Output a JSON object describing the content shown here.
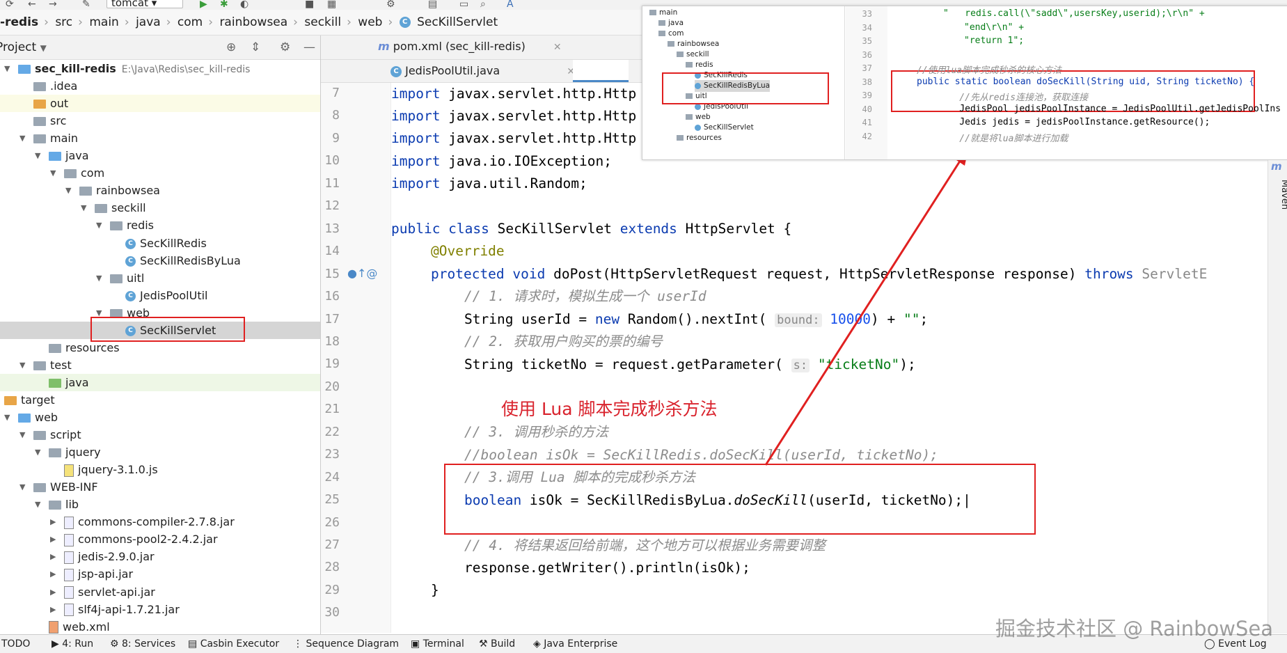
{
  "toolbar": {
    "run_config": "tomcat"
  },
  "breadcrumb": [
    "-redis",
    "src",
    "main",
    "java",
    "com",
    "rainbowsea",
    "seckill",
    "web",
    "SecKillServlet"
  ],
  "project_panel": {
    "title": "Project"
  },
  "tree": [
    {
      "label": "sec_kill-redis",
      "extra": "E:\\Java\\Redis\\sec_kill-redis",
      "indent": 0,
      "arrow": "▼",
      "icon": "module"
    },
    {
      "label": ".idea",
      "indent": 1,
      "icon": "folder"
    },
    {
      "label": "out",
      "indent": 1,
      "icon": "folder-orange"
    },
    {
      "label": "src",
      "indent": 1,
      "icon": "folder"
    },
    {
      "label": "main",
      "indent": 1,
      "arrow": "▼",
      "icon": "folder"
    },
    {
      "label": "java",
      "indent": 2,
      "arrow": "▼",
      "icon": "folder-blue"
    },
    {
      "label": "com",
      "indent": 3,
      "arrow": "▼",
      "icon": "folder"
    },
    {
      "label": "rainbowsea",
      "indent": 4,
      "arrow": "▼",
      "icon": "folder"
    },
    {
      "label": "seckill",
      "indent": 5,
      "arrow": "▼",
      "icon": "folder"
    },
    {
      "label": "redis",
      "indent": 6,
      "arrow": "▼",
      "icon": "folder"
    },
    {
      "label": "SecKillRedis",
      "indent": 7,
      "icon": "class"
    },
    {
      "label": "SecKillRedisByLua",
      "indent": 7,
      "icon": "class"
    },
    {
      "label": "uitl",
      "indent": 6,
      "arrow": "▼",
      "icon": "folder"
    },
    {
      "label": "JedisPoolUtil",
      "indent": 7,
      "icon": "class"
    },
    {
      "label": "web",
      "indent": 6,
      "arrow": "▼",
      "icon": "folder"
    },
    {
      "label": "SecKillServlet",
      "indent": 7,
      "icon": "class"
    },
    {
      "label": "resources",
      "indent": 2,
      "icon": "folder"
    },
    {
      "label": "test",
      "indent": 1,
      "arrow": "▼",
      "icon": "folder"
    },
    {
      "label": "java",
      "indent": 2,
      "icon": "folder-green"
    },
    {
      "label": "target",
      "indent": 0,
      "icon": "folder-orange"
    },
    {
      "label": "web",
      "indent": 0,
      "arrow": "▼",
      "icon": "folder-blue"
    },
    {
      "label": "script",
      "indent": 1,
      "arrow": "▼",
      "icon": "folder"
    },
    {
      "label": "jquery",
      "indent": 2,
      "arrow": "▼",
      "icon": "folder"
    },
    {
      "label": "jquery-3.1.0.js",
      "indent": 3,
      "icon": "js"
    },
    {
      "label": "WEB-INF",
      "indent": 1,
      "arrow": "▼",
      "icon": "folder"
    },
    {
      "label": "lib",
      "indent": 2,
      "arrow": "▼",
      "icon": "folder"
    },
    {
      "label": "commons-compiler-2.7.8.jar",
      "indent": 3,
      "arrow": "▶",
      "icon": "jar"
    },
    {
      "label": "commons-pool2-2.4.2.jar",
      "indent": 3,
      "arrow": "▶",
      "icon": "jar"
    },
    {
      "label": "jedis-2.9.0.jar",
      "indent": 3,
      "arrow": "▶",
      "icon": "jar"
    },
    {
      "label": "jsp-api.jar",
      "indent": 3,
      "arrow": "▶",
      "icon": "jar"
    },
    {
      "label": "servlet-api.jar",
      "indent": 3,
      "arrow": "▶",
      "icon": "jar"
    },
    {
      "label": "slf4j-api-1.7.21.jar",
      "indent": 3,
      "arrow": "▶",
      "icon": "jar"
    },
    {
      "label": "web.xml",
      "indent": 2,
      "icon": "xml"
    }
  ],
  "tabs": {
    "pom": "pom.xml (sec_kill-redis)",
    "jedis": "JedisPoolUtil.java"
  },
  "line_numbers": [
    "7",
    "8",
    "9",
    "10",
    "11",
    "12",
    "13",
    "14",
    "15",
    "16",
    "17",
    "18",
    "19",
    "20",
    "21",
    "22",
    "23",
    "24",
    "25",
    "26",
    "27",
    "28",
    "29",
    "30"
  ],
  "code": {
    "l7": {
      "kw": "import",
      "rest": " javax.servlet.http.Http"
    },
    "l8": {
      "kw": "import",
      "rest": " javax.servlet.http.Http"
    },
    "l9": {
      "kw": "import",
      "rest": " javax.servlet.http.Http"
    },
    "l10": {
      "kw": "import",
      "rest": " java.io.IOException;"
    },
    "l11": {
      "kw": "import",
      "rest": " java.util.Random;"
    },
    "l13a": "public class ",
    "l13b": "SecKillServlet ",
    "l13c": "extends ",
    "l13d": "HttpServlet {",
    "l14": "@Override",
    "l15a": "protected void ",
    "l15b": "doPost(HttpServletRequest request, HttpServletResponse response) ",
    "l15c": "throws ",
    "l15d": "ServletE",
    "l16": "// 1. 请求时，模拟生成一个 userId",
    "l17a": "String userId = ",
    "l17b": "new ",
    "l17c": "Random().nextInt( ",
    "l17hint": "bound:",
    "l17d": " 10000",
    "l17e": ") + ",
    "l17f": "\"\"",
    "l17g": ";",
    "l18": "// 2. 获取用户购买的票的编号",
    "l19a": "String ticketNo = request.getParameter( ",
    "l19hint": "s:",
    "l19b": " \"ticketNo\"",
    "l19c": ");",
    "l22": "// 3. 调用秒杀的方法",
    "l23": "//boolean isOk = SecKillRedis.doSecKill(userId, ticketNo);",
    "l24": "// 3.调用 Lua 脚本的完成秒杀方法",
    "l25a": "boolean ",
    "l25b": "isOk = SecKillRedisByLua.",
    "l25c": "doSecKill",
    "l25d": "(userId, ticketNo);",
    "l27": "// 4. 将结果返回给前端，这个地方可以根据业务需要调整",
    "l28": "response.getWriter().println(isOk);",
    "l29": "}"
  },
  "annotation": "使用 Lua 脚本完成秒杀方法",
  "inset": {
    "tree": [
      "main",
      "java",
      "com",
      "rainbowsea",
      "seckill",
      "redis",
      "SecKillRedis",
      "SecKillRedisByLua",
      "uitl",
      "JedisPoolUtil",
      "web",
      "SecKillServlet",
      "resources"
    ],
    "line_numbers": [
      "33",
      "34",
      "35",
      "36",
      "37",
      "38",
      "39",
      "40",
      "41",
      "42"
    ],
    "code": [
      "\"   redis.call(\\\"sadd\\\",usersKey,userid);\\r\\n\" +",
      "\"end\\r\\n\" +",
      "\"return 1\";",
      "",
      "//使用lua脚本完成秒杀的核心方法",
      "public static boolean doSecKill(String uid, String ticketNo) {",
      "    //先从redis连接池，获取连接",
      "    JedisPool jedisPoolInstance = JedisPoolUtil.getJedisPoolIns",
      "    Jedis jedis = jedisPoolInstance.getResource();",
      "    //就是将lua脚本进行加载"
    ]
  },
  "statusbar": [
    "TODO",
    "4: Run",
    "8: Services",
    "Casbin Executor",
    "Sequence Diagram",
    "Terminal",
    "Build",
    "Java Enterprise",
    "Event Log"
  ],
  "maven": "Maven",
  "watermark": "掘金技术社区 @ RainbowSea"
}
